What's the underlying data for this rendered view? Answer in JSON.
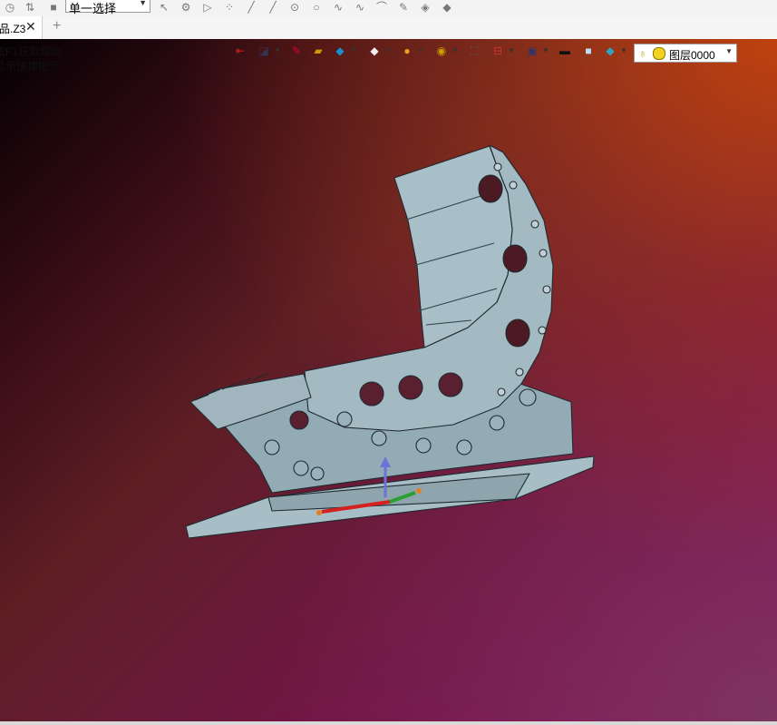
{
  "toolbar": {
    "selection_mode": "单一选择"
  },
  "tabs": [
    {
      "label": "品.Z3",
      "close": "✕"
    }
  ],
  "new_tab": "+",
  "viewport": {
    "hint_lines": [
      "按F1获取帮助",
      "显示快捷提示"
    ],
    "layer_label": "图层0000"
  },
  "colors": {
    "model_fill": "#9bb2bc",
    "model_edge": "#1e2a30"
  }
}
